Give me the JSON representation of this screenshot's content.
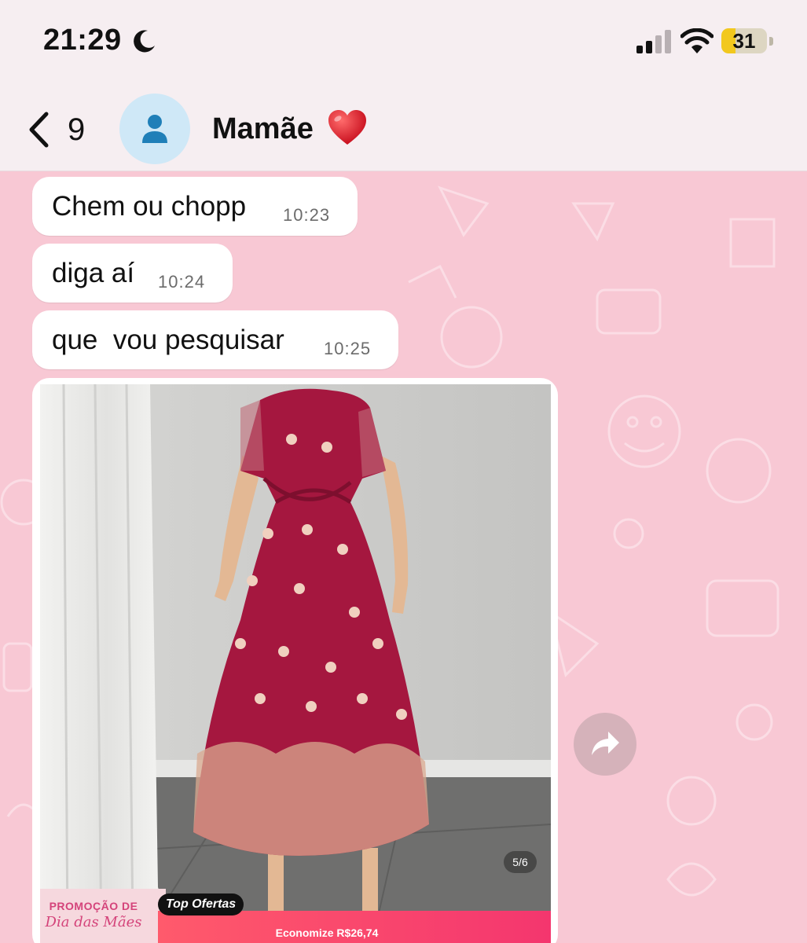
{
  "status_bar": {
    "time": "21:29",
    "battery_level": "31",
    "battery_fraction": 0.31,
    "icons": [
      "moon-icon",
      "cellular-signal-icon",
      "wifi-icon",
      "battery-icon"
    ]
  },
  "header": {
    "unread_count": "9",
    "contact_name": "Mamãe",
    "name_emoji": "heart-icon",
    "avatar_icon": "person-icon"
  },
  "messages": [
    {
      "text": "Chem ou chopp",
      "time": "10:23"
    },
    {
      "text": "diga aí",
      "time": "10:24"
    },
    {
      "text": "que  vou pesquisar",
      "time": "10:25"
    }
  ],
  "image_message": {
    "page_indicator": "5/6",
    "promo_title": "PROMOÇÃO DE",
    "promo_subtitle": "Dia das Mães",
    "top_offers": "Top Ofertas",
    "savings": "Economize R$26,74"
  },
  "colors": {
    "wallpaper": "#f8c8d4",
    "bubble": "#ffffff",
    "dress": "#a5173f"
  }
}
